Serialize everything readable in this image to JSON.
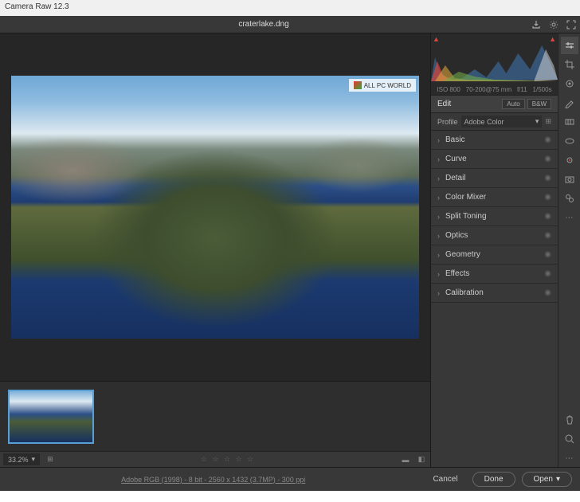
{
  "app": {
    "title": "Camera Raw 12.3",
    "filename": "craterlake.dng"
  },
  "watermark": {
    "text": "ALL PC WORLD"
  },
  "histogram": {
    "iso": "ISO 800",
    "lens": "70-200@75 mm",
    "aperture": "f/11",
    "shutter": "1/500s"
  },
  "edit": {
    "heading": "Edit",
    "auto": "Auto",
    "bw": "B&W",
    "profile_label": "Profile",
    "profile_value": "Adobe Color"
  },
  "panels": [
    {
      "label": "Basic"
    },
    {
      "label": "Curve"
    },
    {
      "label": "Detail"
    },
    {
      "label": "Color Mixer"
    },
    {
      "label": "Split Toning"
    },
    {
      "label": "Optics"
    },
    {
      "label": "Geometry"
    },
    {
      "label": "Effects"
    },
    {
      "label": "Calibration"
    }
  ],
  "zoom": {
    "level": "33.2%"
  },
  "footer": {
    "info": "Adobe RGB (1998) - 8 bit - 2560 x 1432 (3.7MP) - 300 ppi",
    "cancel": "Cancel",
    "done": "Done",
    "open": "Open"
  }
}
